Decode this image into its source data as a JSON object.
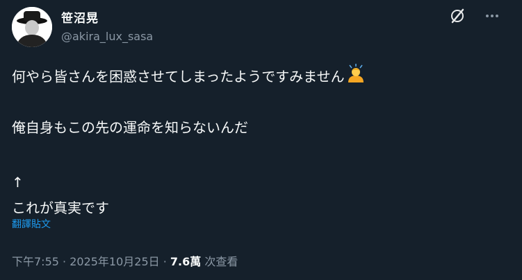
{
  "author": {
    "display_name": "笹沼晃",
    "handle": "@akira_lux_sasa"
  },
  "top_icons": [
    "grok-icon",
    "more-icon"
  ],
  "body": {
    "line1": "何やら皆さんを困惑させてしまったようですみません",
    "line1_emoji": "person-bowing-emoji",
    "line2": "俺自身もこの先の運命を知らないんだ",
    "line3": "↑",
    "line4": "これが真実です"
  },
  "translate_label": "翻譯貼文",
  "meta": {
    "time": "下午7:55",
    "sep1": " · ",
    "date": "2025年10月25日",
    "sep2": " · ",
    "views_count": "7.6萬",
    "views_label": " 次查看"
  },
  "colors": {
    "background": "#15202b",
    "text": "#f7f9f9",
    "secondary": "#8b98a5",
    "link": "#1d9bf0"
  }
}
